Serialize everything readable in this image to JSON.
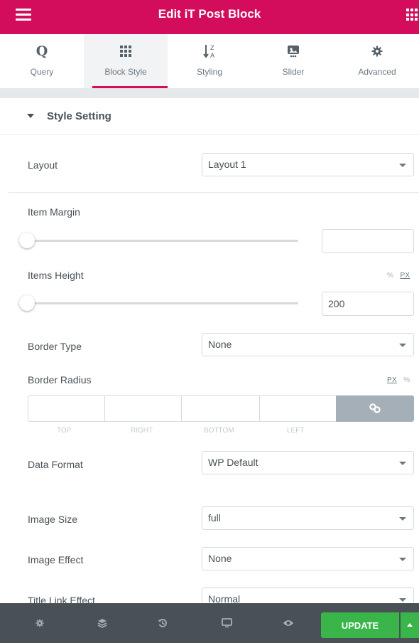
{
  "header": {
    "title": "Edit iT Post Block"
  },
  "tabs": [
    {
      "label": "Query",
      "icon": "q-icon"
    },
    {
      "label": "Block Style",
      "icon": "grid-icon",
      "active": true
    },
    {
      "label": "Styling",
      "icon": "sort-alpha-icon"
    },
    {
      "label": "Slider",
      "icon": "slider-icon"
    },
    {
      "label": "Advanced",
      "icon": "gear-icon"
    }
  ],
  "section": {
    "title": "Style Setting"
  },
  "layout": {
    "label": "Layout",
    "value": "Layout 1"
  },
  "item_margin": {
    "label": "Item Margin",
    "value": ""
  },
  "items_height": {
    "label": "Items Height",
    "value": "200",
    "unit_pct": "%",
    "unit_px": "PX"
  },
  "border_type": {
    "label": "Border Type",
    "value": "None"
  },
  "border_radius": {
    "label": "Border Radius",
    "unit_px": "PX",
    "unit_pct": "%",
    "sides": [
      "TOP",
      "RIGHT",
      "BOTTOM",
      "LEFT"
    ]
  },
  "data_format": {
    "label": "Data Format",
    "value": "WP Default"
  },
  "image_size": {
    "label": "Image Size",
    "value": "full"
  },
  "image_effect": {
    "label": "Image Effect",
    "value": "None"
  },
  "title_link_effect": {
    "label": "Title Link Effect",
    "value": "Normal"
  },
  "footer": {
    "update_label": "UPDATE"
  },
  "colors": {
    "brand": "#d30c5c",
    "update": "#39b54a",
    "footer": "#495157"
  }
}
